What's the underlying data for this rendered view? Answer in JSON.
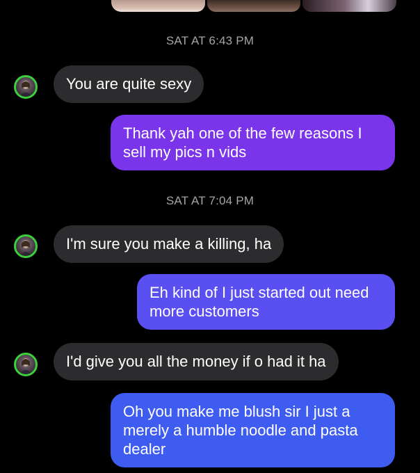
{
  "colors": {
    "background": "#000000",
    "incoming_bubble": "#2c2c2e",
    "outgoing_bubble_1": "#7a34ea",
    "outgoing_bubble_2": "#5a4ff0",
    "outgoing_bubble_3": "#3f5cf0",
    "timestamp_text": "#a6a6a6",
    "avatar_ring": "#3ccf3c"
  },
  "media_strip": {
    "thumbnails": [
      "photo",
      "photo",
      "photo"
    ]
  },
  "conversation": {
    "timestamps": [
      "SAT AT 6:43 PM",
      "SAT AT 7:04 PM"
    ],
    "messages": [
      {
        "direction": "incoming",
        "lines": [
          "You are quite sexy"
        ]
      },
      {
        "direction": "outgoing",
        "lines": [
          "Thank yah one of the few reasons I",
          "sell my pics n vids"
        ]
      },
      {
        "direction": "incoming",
        "lines": [
          "I'm sure you make a killing,  ha"
        ]
      },
      {
        "direction": "outgoing",
        "lines": [
          "Eh kind of I just started out need",
          "more customers"
        ]
      },
      {
        "direction": "incoming",
        "lines": [
          "I'd give you all the money if o had it ha"
        ]
      },
      {
        "direction": "outgoing",
        "lines": [
          "Oh you make me blush sir I just a",
          "merely a humble noodle and pasta",
          "dealer"
        ]
      }
    ]
  }
}
